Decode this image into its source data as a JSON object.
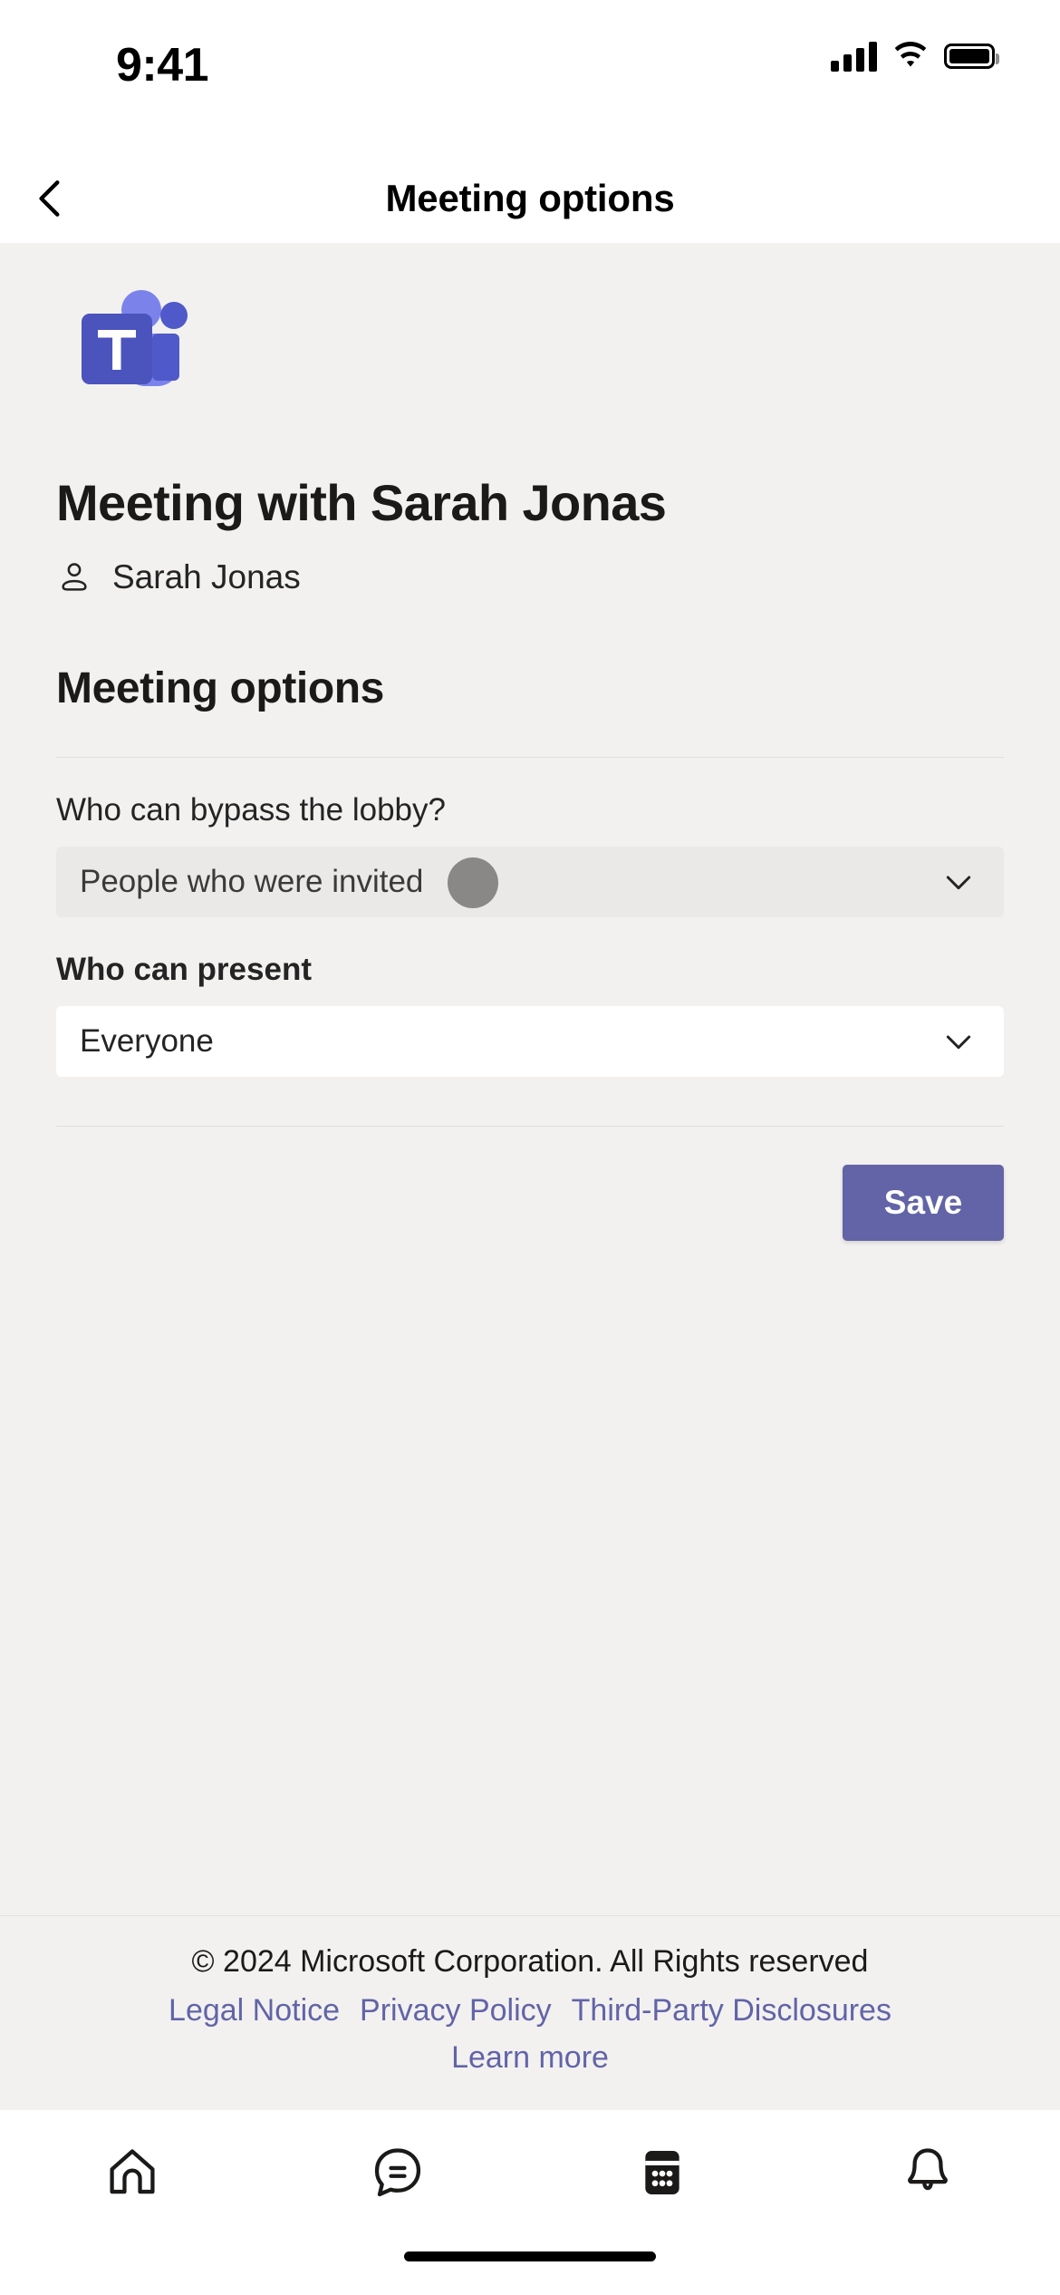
{
  "status_bar": {
    "time": "9:41",
    "signal_icon": "cellular-signal-icon",
    "wifi_icon": "wifi-icon",
    "battery_icon": "battery-full-icon"
  },
  "navbar": {
    "back_icon": "chevron-left-icon",
    "title": "Meeting options"
  },
  "brand": {
    "logo_icon": "microsoft-teams-logo",
    "logo_dark_purple": "#4b53bc",
    "logo_light_purple": "#7b83eb",
    "accent": "#6264a7"
  },
  "meeting": {
    "title": "Meeting with Sarah Jonas",
    "organizer_icon": "person-icon",
    "organizer_name": "Sarah Jonas"
  },
  "options": {
    "heading": "Meeting options",
    "lobby": {
      "label": "Who can bypass the lobby?",
      "value": "People who were invited",
      "chevron_icon": "chevron-down-icon"
    },
    "present": {
      "label": "Who can present",
      "value": "Everyone",
      "chevron_icon": "chevron-down-icon"
    },
    "save_label": "Save"
  },
  "footer": {
    "copyright": "© 2024 Microsoft Corporation. All Rights reserved",
    "links": [
      "Legal Notice",
      "Privacy Policy",
      "Third-Party Disclosures"
    ],
    "learn_more": "Learn more"
  },
  "tabbar": {
    "items": [
      {
        "icon": "home-icon",
        "label": ""
      },
      {
        "icon": "chat-icon",
        "label": ""
      },
      {
        "icon": "calendar-icon",
        "label": ""
      },
      {
        "icon": "bell-icon",
        "label": ""
      }
    ]
  }
}
